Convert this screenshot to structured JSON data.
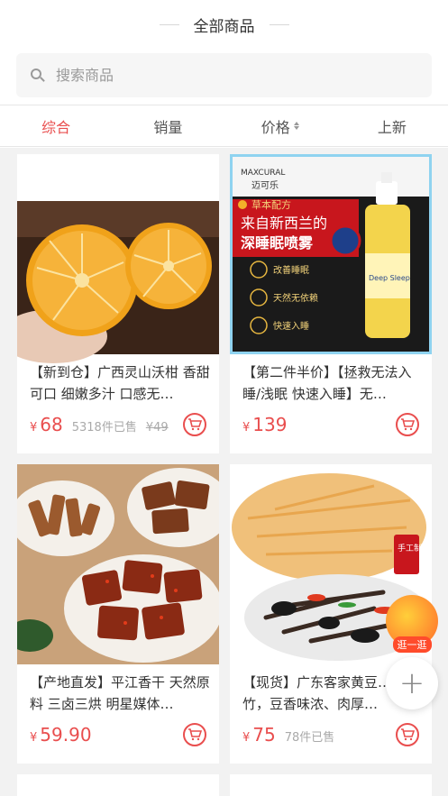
{
  "header": {
    "title": "全部商品"
  },
  "search": {
    "placeholder": "搜索商品"
  },
  "sort_tabs": [
    {
      "label": "综合",
      "active": true
    },
    {
      "label": "销量",
      "active": false
    },
    {
      "label": "价格",
      "active": false,
      "has_sort_arrows": true
    },
    {
      "label": "上新",
      "active": false
    }
  ],
  "products": [
    {
      "title": "【新到仓】广西灵山沃柑 香甜可口 细嫩多汁 口感无…",
      "currency": "¥",
      "price": "68",
      "sold": "5318件已售",
      "original_price": "¥49",
      "image": "orange-halves"
    },
    {
      "title": "【第二件半价】【拯救无法入睡/浅眠 快速入睡】无…",
      "currency": "¥",
      "price": "139",
      "sold": "",
      "original_price": "",
      "image": "sleep-spray-ad",
      "image_text": {
        "brand": "MAXCURAL",
        "brand_cn": "迈可乐",
        "tag": "草本配方",
        "headline1": "来自新西兰的",
        "headline2": "深睡眠喷雾",
        "features": [
          "改善睡眠",
          "天然无依赖",
          "快速入睡"
        ],
        "bottle_label": "Deep Sleep"
      }
    },
    {
      "title": "【产地直发】平江香干 天然原料 三卤三烘 明星媒体…",
      "currency": "¥",
      "price": "59.90",
      "sold": "",
      "original_price": "",
      "image": "dried-tofu"
    },
    {
      "title": "【现货】广东客家黄豆…豆腐竹，豆香味浓、肉厚…",
      "currency": "¥",
      "price": "75",
      "sold": "78件已售",
      "original_price": "",
      "image": "tofu-skin",
      "image_text": {
        "seal": "手工制作"
      }
    }
  ],
  "floating": {
    "promo_label": "逛一逛",
    "add_symbol": "+"
  },
  "colors": {
    "accent": "#e94e4e",
    "background": "#f2f2f2"
  }
}
